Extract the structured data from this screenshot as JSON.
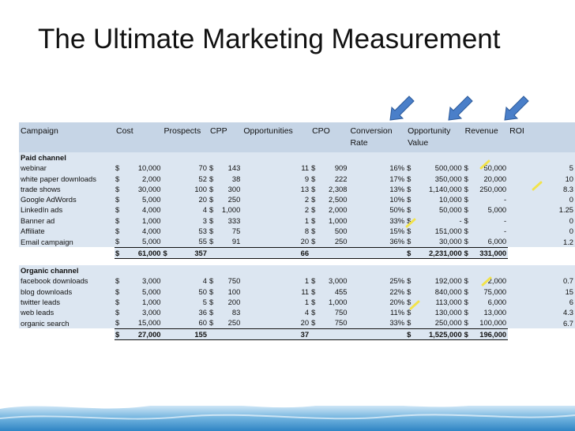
{
  "slide": {
    "title": "The Ultimate Marketing Measurement"
  },
  "icons": {
    "arrow": "blue-arrow-icon",
    "highlight": "yellow-highlight-mark"
  },
  "colors": {
    "header_bg": "#c6d5e6",
    "row_bg": "#dce6f1",
    "arrow_blue": "#4a7fc9",
    "highlight_yellow": "#f2e34a"
  },
  "table": {
    "headers": {
      "campaign": "Campaign",
      "cost": "Cost",
      "prospects": "Prospects",
      "cpp": "CPP",
      "opportunities": "Opportunities",
      "cpo": "CPO",
      "conversion_rate": "Conversion Rate",
      "opportunity_value": "Opportunity Value",
      "revenue": "Revenue",
      "roi": "ROI"
    },
    "paid": {
      "label": "Paid channel",
      "rows": [
        {
          "campaign": "webinar",
          "cost_cur": "$",
          "cost": "10,000",
          "prospects": "70",
          "cpp_cur": "$",
          "cpp": "143",
          "opps": "11",
          "cpo_cur": "$",
          "cpo": "909",
          "conv": "16%",
          "ov_cur": "$",
          "ov": "500,000",
          "rev_cur": "$",
          "rev": "50,000",
          "roi": "5"
        },
        {
          "campaign": "white paper downloads",
          "cost_cur": "$",
          "cost": "2,000",
          "prospects": "52",
          "cpp_cur": "$",
          "cpp": "38",
          "opps": "9",
          "cpo_cur": "$",
          "cpo": "222",
          "conv": "17%",
          "ov_cur": "$",
          "ov": "350,000",
          "rev_cur": "$",
          "rev": "20,000",
          "roi": "10"
        },
        {
          "campaign": "trade shows",
          "cost_cur": "$",
          "cost": "30,000",
          "prospects": "100",
          "cpp_cur": "$",
          "cpp": "300",
          "opps": "13",
          "cpo_cur": "$",
          "cpo": "2,308",
          "conv": "13%",
          "ov_cur": "$",
          "ov": "1,140,000",
          "rev_cur": "$",
          "rev": "250,000",
          "roi": "8.3"
        },
        {
          "campaign": "Google AdWords",
          "cost_cur": "$",
          "cost": "5,000",
          "prospects": "20",
          "cpp_cur": "$",
          "cpp": "250",
          "opps": "2",
          "cpo_cur": "$",
          "cpo": "2,500",
          "conv": "10%",
          "ov_cur": "$",
          "ov": "10,000",
          "rev_cur": "$",
          "rev": "-",
          "roi": "0"
        },
        {
          "campaign": "LinkedIn ads",
          "cost_cur": "$",
          "cost": "4,000",
          "prospects": "4",
          "cpp_cur": "$",
          "cpp": "1,000",
          "opps": "2",
          "cpo_cur": "$",
          "cpo": "2,000",
          "conv": "50%",
          "ov_cur": "$",
          "ov": "50,000",
          "rev_cur": "$",
          "rev": "5,000",
          "roi": "1.25"
        },
        {
          "campaign": "Banner ad",
          "cost_cur": "$",
          "cost": "1,000",
          "prospects": "3",
          "cpp_cur": "$",
          "cpp": "333",
          "opps": "1",
          "cpo_cur": "$",
          "cpo": "1,000",
          "conv": "33%",
          "ov_cur": "$",
          "ov": "-",
          "rev_cur": "$",
          "rev": "-",
          "roi": "0"
        },
        {
          "campaign": "Affiliate",
          "cost_cur": "$",
          "cost": "4,000",
          "prospects": "53",
          "cpp_cur": "$",
          "cpp": "75",
          "opps": "8",
          "cpo_cur": "$",
          "cpo": "500",
          "conv": "15%",
          "ov_cur": "$",
          "ov": "151,000",
          "rev_cur": "$",
          "rev": "-",
          "roi": "0"
        },
        {
          "campaign": "Email campaign",
          "cost_cur": "$",
          "cost": "5,000",
          "prospects": "55",
          "cpp_cur": "$",
          "cpp": "91",
          "opps": "20",
          "cpo_cur": "$",
          "cpo": "250",
          "conv": "36%",
          "ov_cur": "$",
          "ov": "30,000",
          "rev_cur": "$",
          "rev": "6,000",
          "roi": "1.2"
        }
      ],
      "total": {
        "cost_cur": "$",
        "cost": "61,000",
        "prospects_cur": "$",
        "prospects": "357",
        "opps": "66",
        "ov_cur": "$",
        "ov": "2,231,000",
        "rev_cur": "$",
        "rev": "331,000"
      }
    },
    "organic": {
      "label": "Organic channel",
      "rows": [
        {
          "campaign": "facebook downloads",
          "cost_cur": "$",
          "cost": "3,000",
          "prospects": "4",
          "cpp_cur": "$",
          "cpp": "750",
          "opps": "1",
          "cpo_cur": "$",
          "cpo": "3,000",
          "conv": "25%",
          "ov_cur": "$",
          "ov": "192,000",
          "rev_cur": "$",
          "rev": "2,000",
          "roi": "0.7"
        },
        {
          "campaign": "blog downloads",
          "cost_cur": "$",
          "cost": "5,000",
          "prospects": "50",
          "cpp_cur": "$",
          "cpp": "100",
          "opps": "11",
          "cpo_cur": "$",
          "cpo": "455",
          "conv": "22%",
          "ov_cur": "$",
          "ov": "840,000",
          "rev_cur": "$",
          "rev": "75,000",
          "roi": "15"
        },
        {
          "campaign": "twitter leads",
          "cost_cur": "$",
          "cost": "1,000",
          "prospects": "5",
          "cpp_cur": "$",
          "cpp": "200",
          "opps": "1",
          "cpo_cur": "$",
          "cpo": "1,000",
          "conv": "20%",
          "ov_cur": "$",
          "ov": "113,000",
          "rev_cur": "$",
          "rev": "6,000",
          "roi": "6"
        },
        {
          "campaign": "web leads",
          "cost_cur": "$",
          "cost": "3,000",
          "prospects": "36",
          "cpp_cur": "$",
          "cpp": "83",
          "opps": "4",
          "cpo_cur": "$",
          "cpo": "750",
          "conv": "11%",
          "ov_cur": "$",
          "ov": "130,000",
          "rev_cur": "$",
          "rev": "13,000",
          "roi": "4.3"
        },
        {
          "campaign": "organic search",
          "cost_cur": "$",
          "cost": "15,000",
          "prospects": "60",
          "cpp_cur": "$",
          "cpp": "250",
          "opps": "20",
          "cpo_cur": "$",
          "cpo": "750",
          "conv": "33%",
          "ov_cur": "$",
          "ov": "250,000",
          "rev_cur": "$",
          "rev": "100,000",
          "roi": "6.7"
        }
      ],
      "total": {
        "cost_cur": "$",
        "cost": "27,000",
        "prospects": "155",
        "opps": "37",
        "ov_cur": "$",
        "ov": "1,525,000",
        "rev_cur": "$",
        "rev": "196,000"
      }
    }
  }
}
